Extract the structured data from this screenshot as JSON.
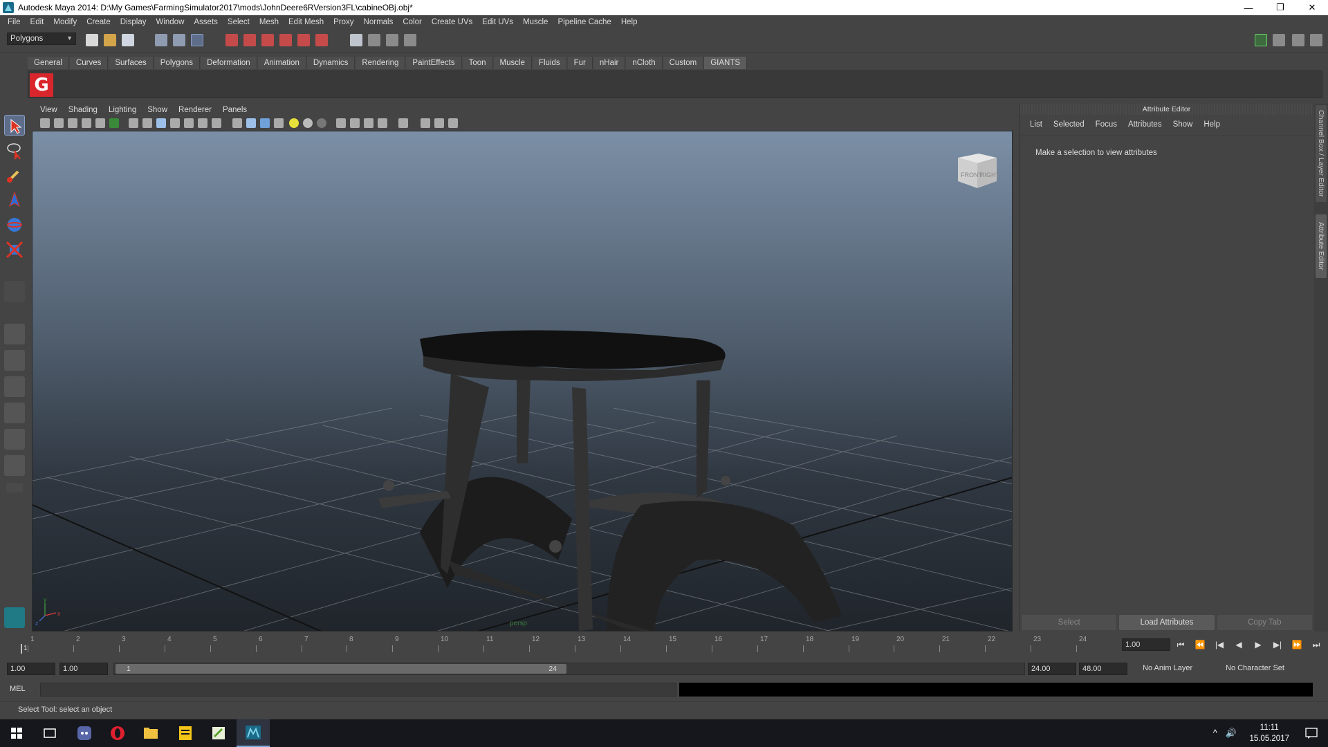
{
  "window": {
    "title": "Autodesk Maya 2014: D:\\My Games\\FarmingSimulator2017\\mods\\JohnDeere6RVersion3FL\\cabineOBj.obj*",
    "controls": [
      "—",
      "❐",
      "✕"
    ]
  },
  "menubar": [
    "File",
    "Edit",
    "Modify",
    "Create",
    "Display",
    "Window",
    "Assets",
    "Select",
    "Mesh",
    "Edit Mesh",
    "Proxy",
    "Normals",
    "Color",
    "Create UVs",
    "Edit UVs",
    "Muscle",
    "Pipeline Cache",
    "Help"
  ],
  "statusline": {
    "mode": "Polygons"
  },
  "shelf": {
    "tabs": [
      "General",
      "Curves",
      "Surfaces",
      "Polygons",
      "Deformation",
      "Animation",
      "Dynamics",
      "Rendering",
      "PaintEffects",
      "Toon",
      "Muscle",
      "Fluids",
      "Fur",
      "nHair",
      "nCloth",
      "Custom",
      "GIANTS"
    ],
    "active_tab": "GIANTS",
    "giants_button": "G"
  },
  "panel": {
    "menu": [
      "View",
      "Shading",
      "Lighting",
      "Show",
      "Renderer",
      "Panels"
    ],
    "viewcube": {
      "front": "FRONT",
      "right": "RIGHT"
    },
    "camera_label": "persp",
    "axis": {
      "x": "x",
      "y": "y",
      "z": "z"
    }
  },
  "attribute_editor": {
    "title": "Attribute Editor",
    "menu": [
      "List",
      "Selected",
      "Focus",
      "Attributes",
      "Show",
      "Help"
    ],
    "message": "Make a selection to view attributes",
    "buttons": {
      "select": "Select",
      "load": "Load Attributes",
      "copy": "Copy Tab"
    },
    "side_tabs": [
      "Channel Box / Layer Editor",
      "Attribute Editor"
    ]
  },
  "timeslider": {
    "ticks": [
      "1",
      "2",
      "3",
      "4",
      "5",
      "6",
      "7",
      "8",
      "9",
      "10",
      "11",
      "12",
      "13",
      "14",
      "15",
      "16",
      "17",
      "18",
      "19",
      "20",
      "21",
      "22",
      "23",
      "24"
    ],
    "current_frame": "1.00",
    "playhead_frame": "1",
    "playback_controls": [
      "⏮",
      "⏪",
      "|◀",
      "◀",
      "▶",
      "▶|",
      "⏩",
      "⏭"
    ]
  },
  "range": {
    "start": "1.00",
    "playback_start": "1.00",
    "handle_start": "1",
    "handle_end": "24",
    "playback_end": "24.00",
    "end": "48.00",
    "anim_layer": "No Anim Layer",
    "character_set": "No Character Set"
  },
  "cmdline": {
    "label": "MEL"
  },
  "helpline": {
    "text": "Select Tool: select an object"
  },
  "taskbar": {
    "clock_time": "11:11",
    "clock_date": "15.05.2017",
    "tray": [
      "^",
      "🔊"
    ]
  },
  "colors": {
    "maya_ui": "#444444",
    "viewport_top": "#7b8fa6",
    "viewport_bottom": "#20252b",
    "giants_red": "#d8262c",
    "selected_tool": "#5d6d8a"
  }
}
